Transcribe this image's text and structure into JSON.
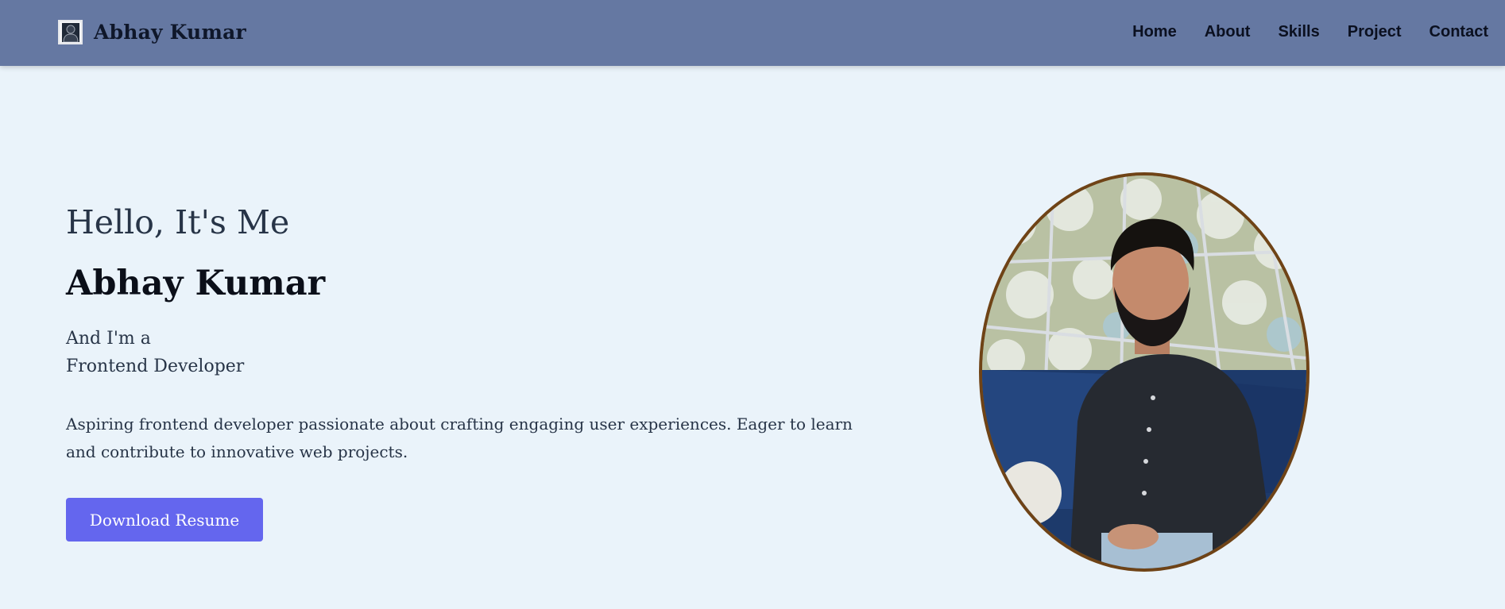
{
  "navbar": {
    "brand_title": "Abhay Kumar",
    "brand_icon": "user-portrait-icon",
    "links": [
      "Home",
      "About",
      "Skills",
      "Project",
      "Contact"
    ]
  },
  "hero": {
    "greeting": "Hello, It's Me",
    "name": "Abhay Kumar",
    "role_line1": "And I'm a",
    "role_line2": "Frontend Developer",
    "description": "Aspiring frontend developer passionate about crafting engaging user experiences. Eager to learn and contribute to innovative web projects.",
    "button_label": "Download Resume"
  },
  "colors": {
    "navbar_bg": "#6578a2",
    "page_bg": "#eaf3fa",
    "button_bg": "#6466ee",
    "photo_border": "#6f4316"
  }
}
